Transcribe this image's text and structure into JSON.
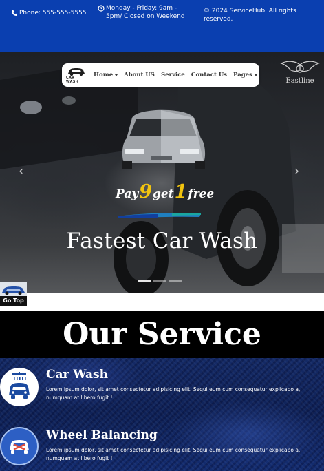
{
  "topbar": {
    "phone": "Phone: 555-555-5555",
    "hours": "Monday - Friday: 9am - 5pm/ Closed on Weekend",
    "copyright": "© 2024 ServiceHub. All rights reserved."
  },
  "navbar": {
    "logo_text": "CAR WASH",
    "items": [
      {
        "label": "Home",
        "dropdown": true
      },
      {
        "label": "About US",
        "dropdown": false
      },
      {
        "label": "Service",
        "dropdown": false
      },
      {
        "label": "Contact Us",
        "dropdown": false
      },
      {
        "label": "Pages",
        "dropdown": true
      }
    ]
  },
  "hero": {
    "watermark": "Eastline",
    "promo": {
      "pay": "Pay",
      "nine": "9",
      "get": "get",
      "one": "1",
      "free": "free"
    },
    "title": "Fastest Car Wash",
    "slide_count": 3,
    "active_slide": 1
  },
  "go_top": {
    "label": "Go Top"
  },
  "services": {
    "heading": "Our Service",
    "items": [
      {
        "title": "Car Wash",
        "description": "Lorem ipsum dolor, sit amet consectetur adipisicing elit. Sequi eum cum consequatur explicabo a, numquam at libero fugit !",
        "icon": "car-wash-icon"
      },
      {
        "title": "Wheel Balancing",
        "description": "Lorem ipsum dolor, sit amet consectetur adipisicing elit. Sequi eum cum consequatur explicabo a, numquam at libero fugit !",
        "icon": "wheel-balancing-icon"
      }
    ]
  },
  "colors": {
    "topbar_bg": "#0a3fb0",
    "promo_yellow": "#f2c40f",
    "service_bg": "#132c70"
  }
}
